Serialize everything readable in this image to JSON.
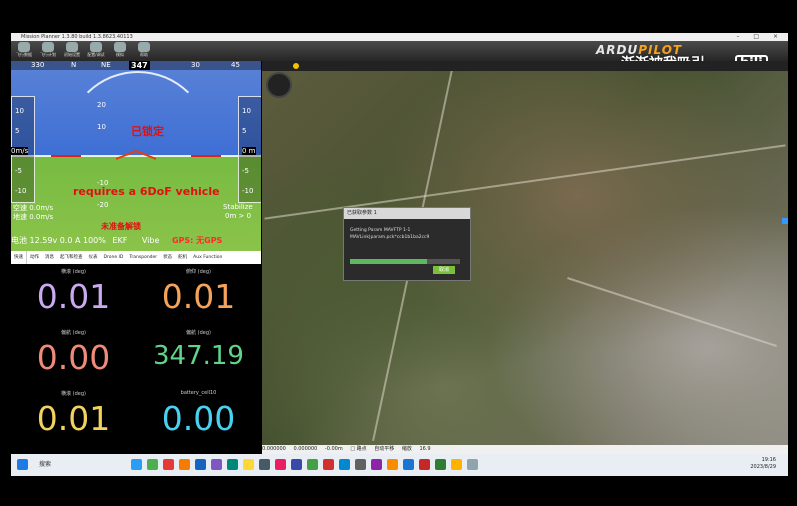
{
  "window": {
    "title": "Mission Planner 1.3.80 build 1.3.8623.40113",
    "controls": "– □ ×"
  },
  "toolbar": {
    "items": [
      "飞行数据",
      "飞行计划",
      "初始设置",
      "配置/调试",
      "模拟",
      "帮助"
    ],
    "logo_a": "ARDU",
    "logo_b": "PILOT",
    "watermark": "渐渐被我吸引",
    "watermark_logo": "bili"
  },
  "hud": {
    "heading": "347",
    "top_scale": [
      "330",
      "N",
      "NE",
      "15",
      "30",
      "45"
    ],
    "left_tape": [
      "10",
      "5",
      "0m/s",
      "-5",
      "-10"
    ],
    "right_tape": [
      "10",
      "5",
      "0 m",
      "-5",
      "-10"
    ],
    "pitch_labels": [
      "20",
      "10",
      "-10",
      "-20"
    ],
    "locked": "已锁定",
    "vehicle_msg": "requires a 6DoF vehicle",
    "not_ready": "未准备解锁",
    "speed_left": "空速 0.0m/s",
    "speed_left2": "地速 0.0m/s",
    "stabilize": "Stabilize",
    "dist": "0m > 0",
    "status_batt": "电池 12.59v 0.0 A 100%",
    "status_ekf": "EKF",
    "status_vibe": "Vibe",
    "status_gps": "GPS: 无GPS"
  },
  "tabs": [
    "快速",
    "动作",
    "消息",
    "起飞和检查",
    "仪表",
    "Drone ID",
    "Transponder",
    "状态",
    "舵机",
    "Aux Function"
  ],
  "quick": [
    {
      "label": "横滚 (deg)",
      "value": "0.01",
      "color": "#c9a9f0"
    },
    {
      "label": "俯仰 (deg)",
      "value": "0.01",
      "color": "#f5a25d"
    },
    {
      "label": "偏航 (deg)",
      "value": "0.00",
      "color": "#f08a7a"
    },
    {
      "label": "偏航 (deg)",
      "value": "347.19",
      "color": "#5fd48a"
    },
    {
      "label": "横滚 (deg)",
      "value": "0.01",
      "color": "#f2d25e"
    },
    {
      "label": "battery_cell10",
      "value": "0.00",
      "color": "#49d2f0"
    }
  ],
  "dialog": {
    "title": "已获取参数 1",
    "line1": "Getting Param MAVFTP 1-1",
    "line2": "MAVLink|param.pck*ccb1b1ba2cc9",
    "progress": 0.7,
    "cancel": "取消"
  },
  "map_bottom": {
    "items": [
      "0.000000",
      "0.000000",
      "-0.00m",
      "□ 路点",
      "自动平移",
      "缩放",
      "16.9"
    ]
  },
  "taskbar": {
    "search": "搜索",
    "time": "19:16",
    "date": "2023/8/29"
  }
}
